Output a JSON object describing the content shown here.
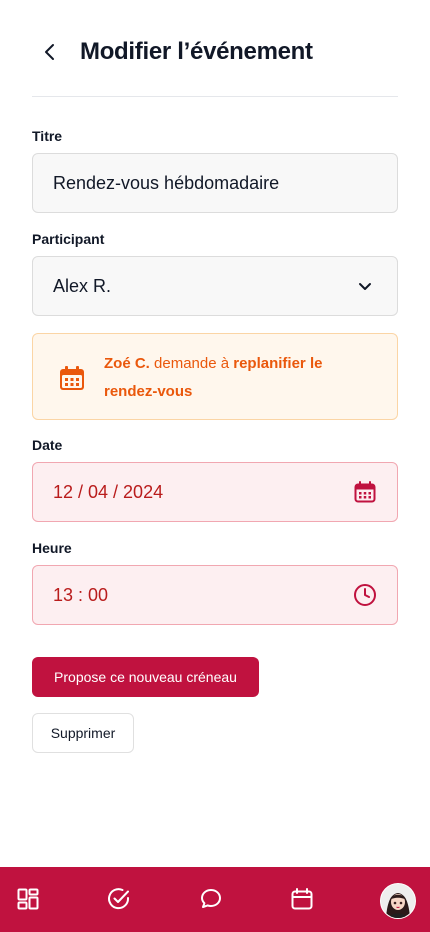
{
  "header": {
    "title": "Modifier l’événement"
  },
  "form": {
    "title_label": "Titre",
    "title_value": "Rendez-vous hébdomadaire",
    "participant_label": "Participant",
    "participant_value": "Alex R.",
    "date_label": "Date",
    "date_value": "12 / 04 / 2024",
    "time_label": "Heure",
    "time_value": "13 : 00"
  },
  "notice": {
    "requester": "Zoé C.",
    "text": " demande à ",
    "action": "replanifier le rendez-vous"
  },
  "buttons": {
    "propose": "Propose ce nouveau créneau",
    "delete": "Supprimer"
  },
  "colors": {
    "brand": "#c0123f",
    "warning": "#ea580c",
    "error": "#b91c1c"
  },
  "bottom_nav": [
    "dashboard-icon",
    "check-circle-icon",
    "chat-icon",
    "calendar-icon",
    "avatar"
  ]
}
